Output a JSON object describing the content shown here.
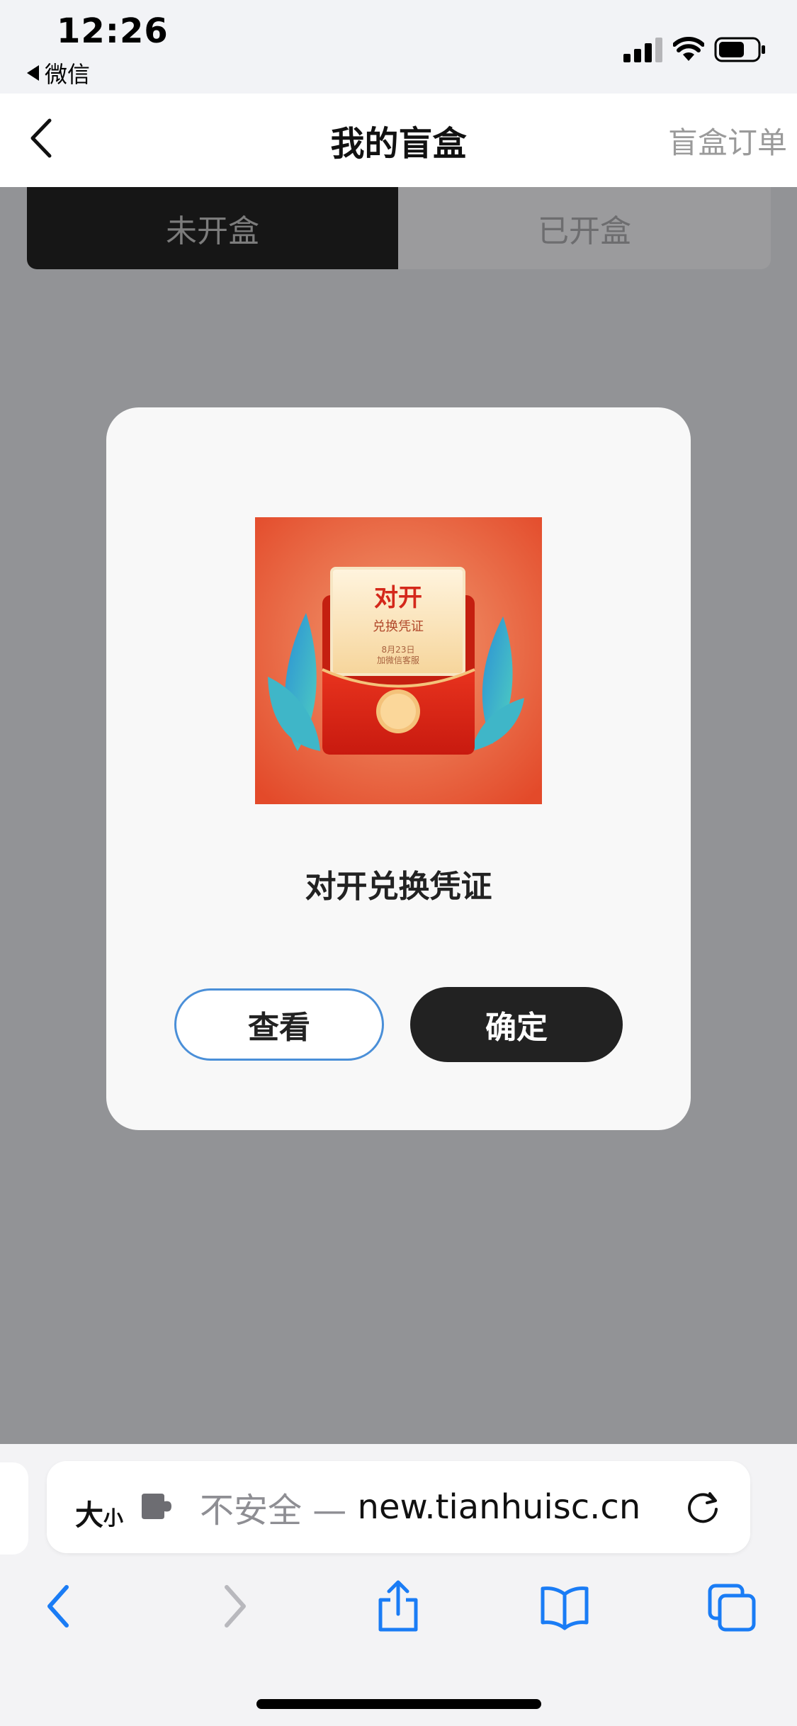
{
  "status_bar": {
    "time": "12:26",
    "back_app_label": "微信"
  },
  "nav": {
    "title": "我的盲盒",
    "orders_link": "盲盒订单"
  },
  "tabs": [
    {
      "label": "未开盒",
      "selected": true
    },
    {
      "label": "已开盒",
      "selected": false
    }
  ],
  "modal": {
    "image_texts": {
      "title": "对开",
      "subtitle": "兑换凭证",
      "line1": "8月23日",
      "line2": "加微信客服"
    },
    "item_name": "对开兑换凭证",
    "view_label": "查看",
    "confirm_label": "确定"
  },
  "safari": {
    "text_size_big": "大",
    "text_size_small": "小",
    "insecure_label": "不安全 —",
    "host": "new.tianhuisc.cn"
  },
  "colors": {
    "overlay": "#929396",
    "modal_bg": "#f8f8f8",
    "confirm_bg": "#222222",
    "view_border": "#4a8fd8",
    "ios_blue": "#1a7cf5",
    "voucher_red": "#e34a2a"
  },
  "icons": {
    "back": "chevron-left-icon",
    "signal": "signal-bars-icon",
    "wifi": "wifi-icon",
    "battery": "battery-icon",
    "extension": "puzzle-piece-icon",
    "reload": "reload-icon",
    "toolbar": [
      "chevron-left-icon",
      "chevron-right-icon",
      "share-icon",
      "bookmarks-book-icon",
      "tabs-icon"
    ]
  }
}
